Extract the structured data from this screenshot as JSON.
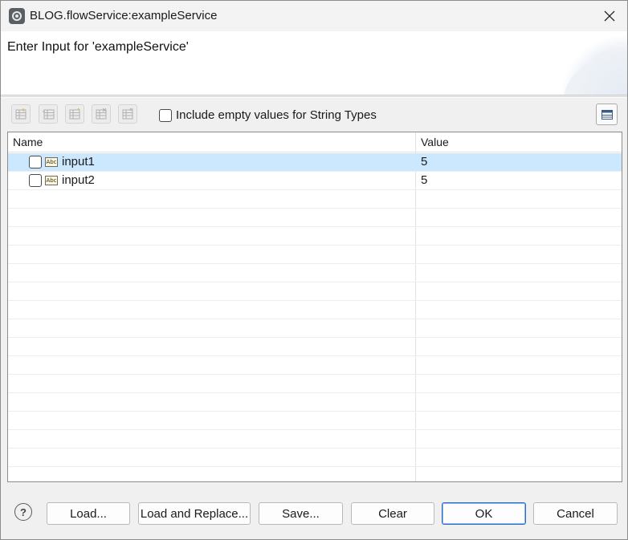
{
  "window": {
    "title": "BLOG.flowService:exampleService"
  },
  "banner": {
    "title": "Enter Input for 'exampleService'"
  },
  "toolbar": {
    "buttons": [
      "add-row-icon",
      "insert-row-icon",
      "add-child-icon",
      "delete-row-icon",
      "delete-all-icon"
    ],
    "include_empty_label": "Include empty values for String Types",
    "include_empty_checked": false,
    "view_toggle_icon": "table-view-icon"
  },
  "table": {
    "columns": [
      "Name",
      "Value"
    ],
    "rows": [
      {
        "name": "input1",
        "value": "5",
        "type_icon": "string-type-icon",
        "type_label": "Abc",
        "selected": true,
        "checked": false
      },
      {
        "name": "input2",
        "value": "5",
        "type_icon": "string-type-icon",
        "type_label": "Abc",
        "selected": false,
        "checked": false
      }
    ]
  },
  "footer": {
    "help": "?",
    "load": "Load...",
    "load_replace": "Load and Replace...",
    "save": "Save...",
    "clear": "Clear",
    "ok": "OK",
    "cancel": "Cancel"
  },
  "colors": {
    "selection": "#cce8ff",
    "primary_border": "#2b6cc4"
  }
}
